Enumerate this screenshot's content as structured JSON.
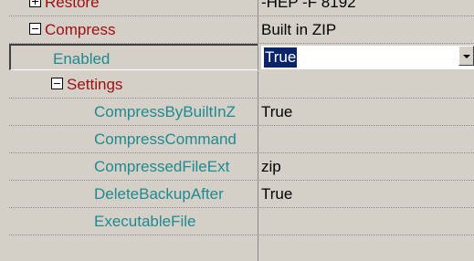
{
  "rows": {
    "restore": {
      "label": "Restore",
      "value": "-HEP -F 8192"
    },
    "compress": {
      "label": "Compress",
      "value": "Built in ZIP"
    },
    "enabled": {
      "label": "Enabled",
      "value": "True"
    },
    "settings": {
      "label": "Settings",
      "value": ""
    },
    "compress_by_builtin": {
      "label": "CompressByBuiltInZ",
      "value": "True"
    },
    "compress_command": {
      "label": "CompressCommand",
      "value": ""
    },
    "compressed_file_ext": {
      "label": "CompressedFileExt",
      "value": "zip"
    },
    "delete_backup_after": {
      "label": "DeleteBackupAfter",
      "value": "True"
    },
    "executable_file": {
      "label": "ExecutableFile",
      "value": ""
    }
  },
  "icons": {
    "collapse": "minus-box-icon",
    "expand": "plus-box-icon",
    "dropdown": "chevron-down-icon"
  },
  "colors": {
    "category_text": "#a01010",
    "property_text": "#1f8a8f",
    "selection_bg": "#0a246a",
    "background": "#d4d0c8"
  }
}
